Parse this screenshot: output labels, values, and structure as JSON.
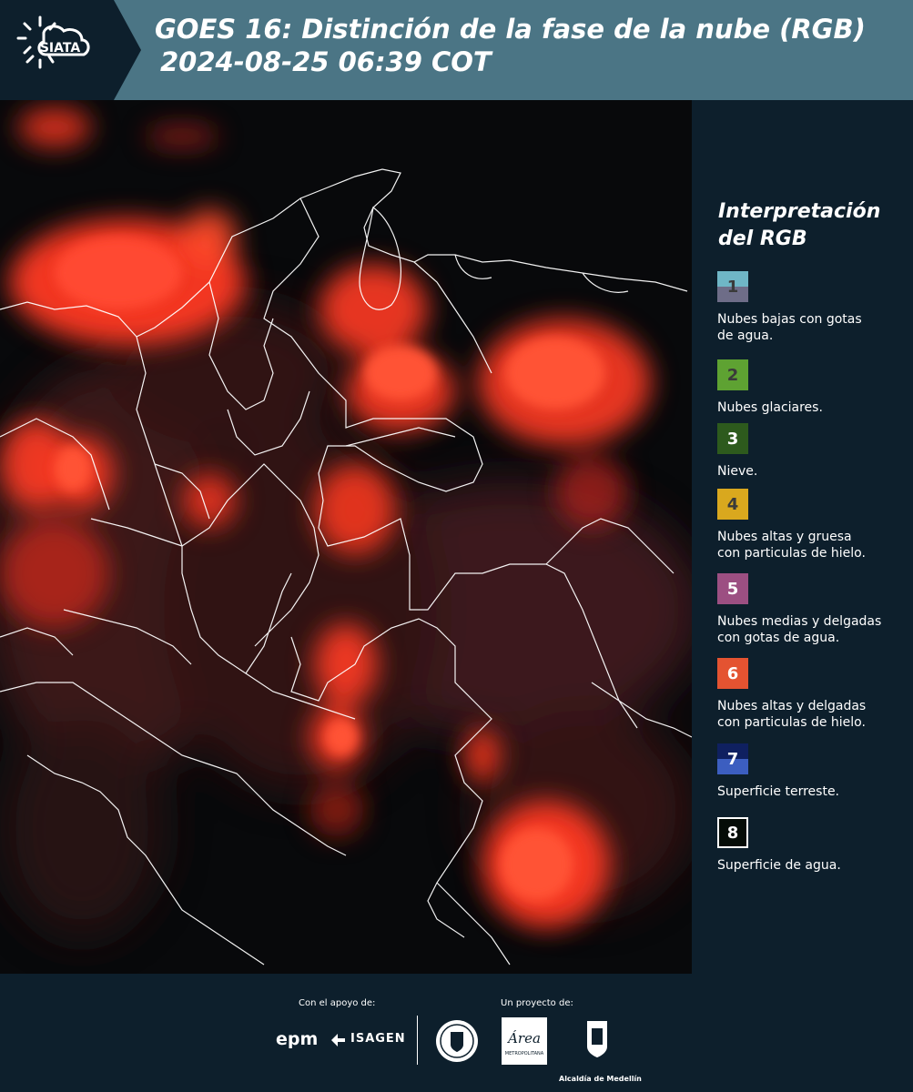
{
  "header": {
    "logo_text": "SIATA",
    "title_line1": "GOES 16: Distinción de la fase de la nube (RGB)",
    "title_line2": "2024-08-25 06:39 COT"
  },
  "legend": {
    "title_line1": "Interpretación",
    "title_line2": "del RGB",
    "items": [
      {
        "number": "1",
        "label_line1": "Nubes bajas con gotas",
        "label_line2": "de agua.",
        "color_top": "#6fb6c6",
        "color_bottom": "#6e6d88"
      },
      {
        "number": "2",
        "label_line1": "Nubes glaciares.",
        "label_line2": "",
        "color_top": "#5ea232",
        "color_bottom": "#5ea232"
      },
      {
        "number": "3",
        "label_line1": "Nieve.",
        "label_line2": "",
        "color_top": "#2d5a1d",
        "color_bottom": "#2d5a1d"
      },
      {
        "number": "4",
        "label_line1": "Nubes altas y gruesa",
        "label_line2": "con particulas de hielo.",
        "color_top": "#d9a81e",
        "color_bottom": "#d9a81e"
      },
      {
        "number": "5",
        "label_line1": "Nubes medias y delgadas",
        "label_line2": "con gotas de agua.",
        "color_top": "#9c4f82",
        "color_bottom": "#9c4f82"
      },
      {
        "number": "6",
        "label_line1": "Nubes altas y delgadas",
        "label_line2": "con particulas de hielo.",
        "color_top": "#e45331",
        "color_bottom": "#e45331"
      },
      {
        "number": "7",
        "label_line1": "Superficie terreste.",
        "label_line2": "",
        "color_top": "#0f2060",
        "color_bottom": "#3c5ec0"
      },
      {
        "number": "8",
        "label_line1": "Superficie de agua.",
        "label_line2": "",
        "color_top": "#050c07",
        "color_bottom": "#050c07"
      }
    ]
  },
  "footer": {
    "support_label": "Con el apoyo de:",
    "project_label": "Un proyecto de:",
    "epm_text": "epm",
    "isagen_text": "ISAGEN",
    "area_text": "Área",
    "area_sub": "METROPOLITANA",
    "alcaldia_text": "Alcaldía de Medellín"
  },
  "colors": {
    "header_bg": "#4b7585",
    "logo_bg": "#0d1f2c",
    "panel_bg": "#0d1f2c",
    "cloud_red": "#ff3a22",
    "border_white": "#ffffff"
  }
}
